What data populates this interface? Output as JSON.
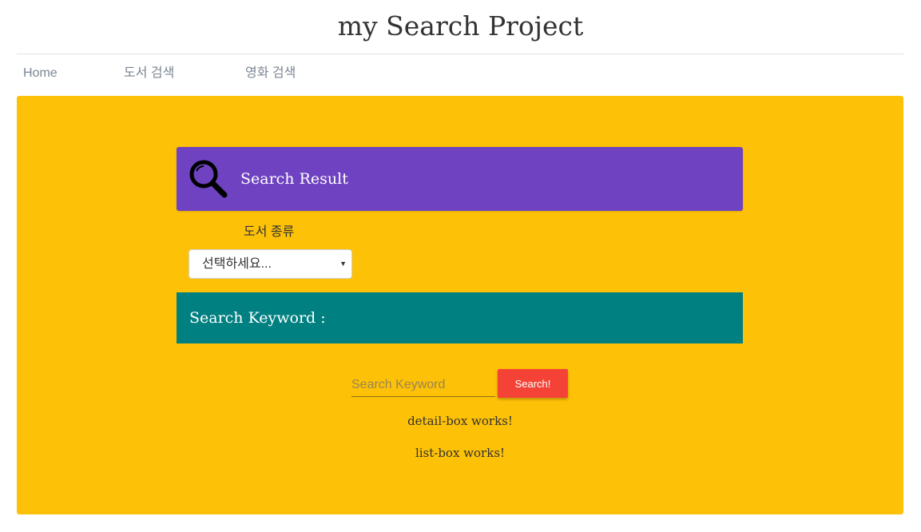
{
  "header": {
    "site_title": "my Search Project"
  },
  "nav": {
    "items": [
      {
        "label": "Home"
      },
      {
        "label": "도서 검색"
      },
      {
        "label": "영화 검색"
      }
    ]
  },
  "result_panel": {
    "icon": "magnifier-icon",
    "title": "Search Result",
    "color": "#6f42c1"
  },
  "category": {
    "label": "도서 종류",
    "selected": "선택하세요..."
  },
  "keyword_panel": {
    "title": "Search Keyword :",
    "color": "#008080"
  },
  "search": {
    "placeholder": "Search Keyword",
    "value": "",
    "button_label": "Search!",
    "button_color": "#f44336"
  },
  "detail_box": {
    "text": "detail-box works!"
  },
  "list_box": {
    "text": "list-box works!"
  },
  "colors": {
    "main_background": "#fdc107"
  }
}
